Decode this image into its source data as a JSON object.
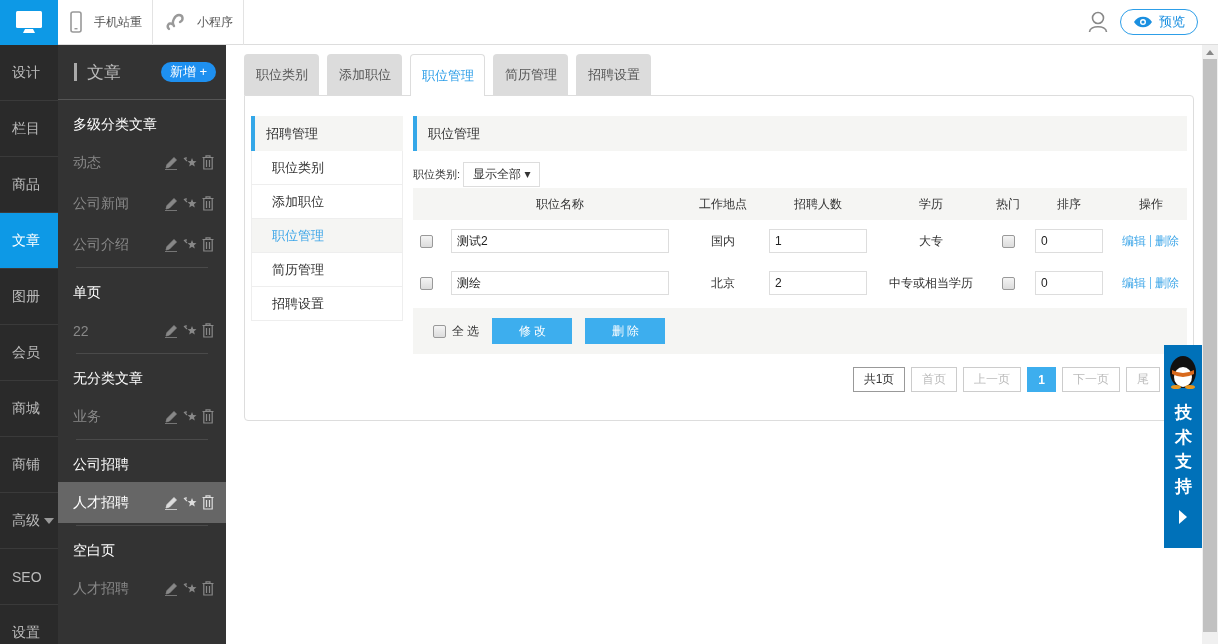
{
  "top_bar": {
    "links": [
      {
        "label": "手机站重"
      },
      {
        "label": "小程序"
      }
    ],
    "preview_button": "预览"
  },
  "rail": [
    {
      "label": "设计",
      "selected": false
    },
    {
      "label": "栏目",
      "selected": false
    },
    {
      "label": "商品",
      "selected": false
    },
    {
      "label": "文章",
      "selected": true
    },
    {
      "label": "图册",
      "selected": false
    },
    {
      "label": "会员",
      "selected": false
    },
    {
      "label": "商城",
      "selected": false
    },
    {
      "label": "商铺",
      "selected": false
    },
    {
      "label": "高级",
      "selected": false,
      "has_menu": true
    },
    {
      "label": "SEO",
      "selected": false
    },
    {
      "label": "设置",
      "selected": false
    }
  ],
  "sidebar": {
    "title": "文章",
    "add_button": "新增 +",
    "groups": [
      {
        "title": "多级分类文章",
        "items": [
          {
            "label": "动态",
            "selected": false
          },
          {
            "label": "公司新闻",
            "selected": false
          },
          {
            "label": "公司介绍",
            "selected": false
          }
        ]
      },
      {
        "title": "单页",
        "items": [
          {
            "label": "22",
            "selected": false
          }
        ]
      },
      {
        "title": "无分类文章",
        "items": [
          {
            "label": "业务",
            "selected": false
          }
        ]
      },
      {
        "title": "公司招聘",
        "items": [
          {
            "label": "人才招聘",
            "selected": true
          }
        ]
      },
      {
        "title": "空白页",
        "items": [
          {
            "label": "人才招聘",
            "selected": false
          }
        ]
      }
    ]
  },
  "tabs": [
    {
      "label": "职位类别",
      "selected": false
    },
    {
      "label": "添加职位",
      "selected": false
    },
    {
      "label": "职位管理",
      "selected": true
    },
    {
      "label": "简历管理",
      "selected": false
    },
    {
      "label": "招聘设置",
      "selected": false
    }
  ],
  "subnav": {
    "title": "招聘管理",
    "items": [
      {
        "label": "职位类别",
        "selected": false
      },
      {
        "label": "添加职位",
        "selected": false
      },
      {
        "label": "职位管理",
        "selected": true
      },
      {
        "label": "简历管理",
        "selected": false
      },
      {
        "label": "招聘设置",
        "selected": false
      }
    ]
  },
  "content": {
    "title": "职位管理",
    "filter": {
      "label": "职位类别:",
      "value": "显示全部 ▾"
    },
    "table": {
      "columns": [
        "职位名称",
        "工作地点",
        "招聘人数",
        "学历",
        "热门",
        "排序",
        "操作"
      ],
      "rows": [
        {
          "checked": false,
          "name": "测试2",
          "location": "国内",
          "count": "1",
          "education": "大专",
          "hot": false,
          "order": "0",
          "edit": "编辑",
          "delete": "删除"
        },
        {
          "checked": false,
          "name": "测绘",
          "location": "北京",
          "count": "2",
          "education": "中专或相当学历",
          "hot": false,
          "order": "0",
          "edit": "编辑",
          "delete": "删除"
        }
      ]
    },
    "footer": {
      "select_all": {
        "label": "全 选",
        "checked": false
      },
      "buttons": [
        "修 改",
        "删 除"
      ]
    },
    "pagination": [
      {
        "label": "共1页",
        "kind": "info"
      },
      {
        "label": "首页",
        "kind": "disabled"
      },
      {
        "label": "上一页",
        "kind": "disabled"
      },
      {
        "label": "1",
        "kind": "current"
      },
      {
        "label": "下一页",
        "kind": "disabled"
      },
      {
        "label": "尾",
        "kind": "disabled"
      }
    ]
  },
  "support_panel": {
    "label": "技术支持"
  }
}
